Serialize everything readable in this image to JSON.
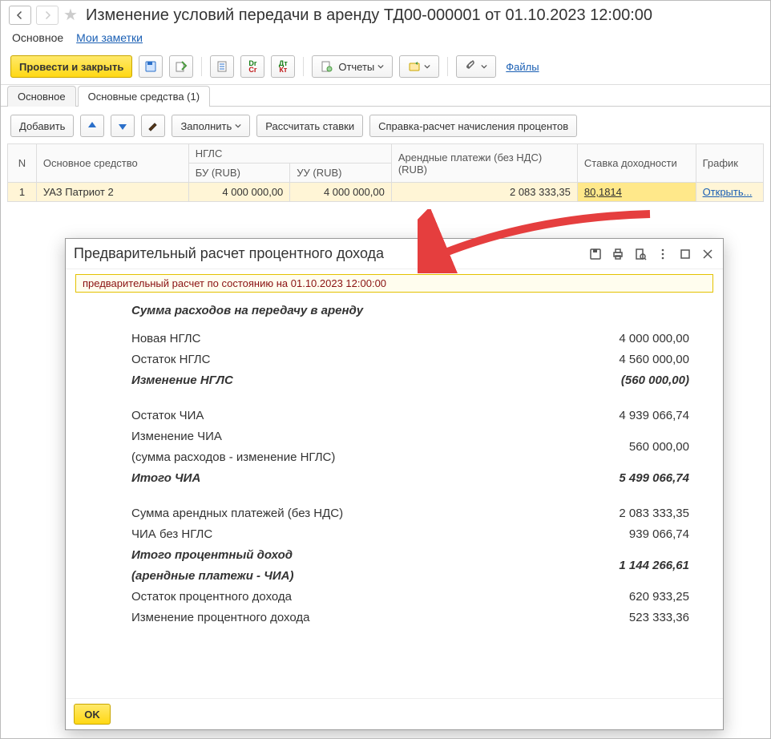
{
  "header": {
    "title": "Изменение условий передачи в аренду ТД00-000001 от 01.10.2023 12:00:00"
  },
  "subnav": {
    "main": "Основное",
    "notes": "Мои заметки"
  },
  "cmdbar": {
    "post_close": "Провести и закрыть",
    "reports": "Отчеты",
    "files": "Файлы"
  },
  "tabs": {
    "main": "Основное",
    "assets": "Основные средства (1)"
  },
  "grid_toolbar": {
    "add": "Добавить",
    "fill": "Заполнить",
    "calc": "Рассчитать ставки",
    "ref": "Справка-расчет начисления процентов"
  },
  "grid": {
    "cols": {
      "n": "N",
      "asset": "Основное средство",
      "ngls": "НГЛС",
      "bu": "БУ (RUB)",
      "uu": "УУ (RUB)",
      "payments": "Арендные платежи (без НДС) (RUB)",
      "rate": "Ставка доходности",
      "schedule": "График"
    },
    "row": {
      "n": "1",
      "asset": "УАЗ Патриот 2",
      "bu": "4 000 000,00",
      "uu": "4 000 000,00",
      "payments": "2 083 333,35",
      "rate": "80,1814",
      "schedule": "Открыть..."
    }
  },
  "dialog": {
    "title": "Предварительный расчет процентного дохода",
    "notice": "предварительный расчет по состоянию на 01.10.2023 12:00:00",
    "section1": "Сумма расходов на передачу в аренду",
    "rows": {
      "r1l": "Новая НГЛС",
      "r1v": "4 000 000,00",
      "r2l": "Остаток НГЛС",
      "r2v": "4 560 000,00",
      "r3l": "Изменение НГЛС",
      "r3v": "(560 000,00)",
      "r4l": "Остаток ЧИА",
      "r4v": "4 939 066,74",
      "r5l": "Изменение ЧИА",
      "r5v": "560 000,00",
      "r5sub": "(сумма расходов - изменение НГЛС)",
      "r6l": "Итого ЧИА",
      "r6v": "5 499 066,74",
      "r7l": "Сумма арендных платежей (без НДС)",
      "r7v": "2 083 333,35",
      "r8l": "ЧИА без НГЛС",
      "r8v": "939 066,74",
      "r9l": "Итого процентный доход",
      "r9v": "1 144 266,61",
      "r9sub": "(арендные платежи - ЧИА)",
      "r10l": "Остаток процентного дохода",
      "r10v": "620 933,25",
      "r11l": "Изменение процентного дохода",
      "r11v": "523 333,36"
    },
    "ok": "OK"
  }
}
